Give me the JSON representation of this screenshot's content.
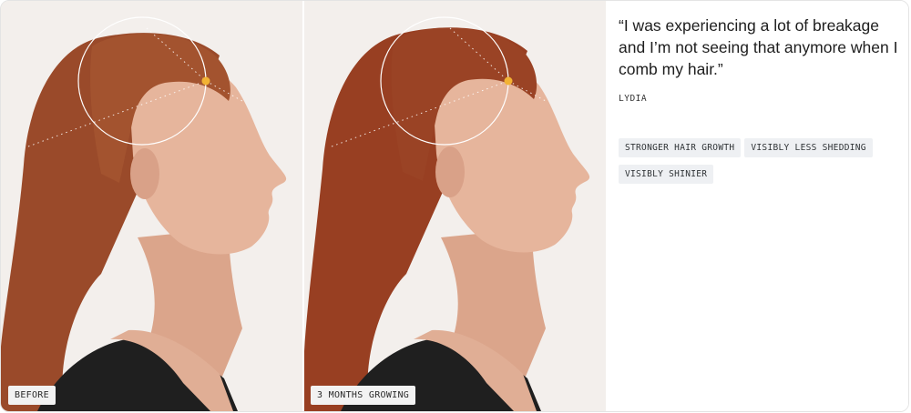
{
  "photos": {
    "before_label": "BEFORE",
    "after_label": "3 MONTHS GROWING"
  },
  "testimonial": {
    "quote": "“I was experiencing a lot of breakage and I’m not seeing that anymore when I comb my hair.”",
    "author": "LYDIA"
  },
  "tags": [
    "STRONGER HAIR GROWTH",
    "VISIBLY LESS SHEDDING",
    "VISIBLY SHINIER"
  ],
  "colors": {
    "highlight_dot": "#f2b233",
    "hair": "#9a4a2a",
    "skin": "#e6b59c",
    "top": "#1f1f1f",
    "background": "#f3efec",
    "tag_bg": "#eef0f3"
  },
  "icons": [
    "focus-circle-icon",
    "highlight-dot-icon"
  ]
}
